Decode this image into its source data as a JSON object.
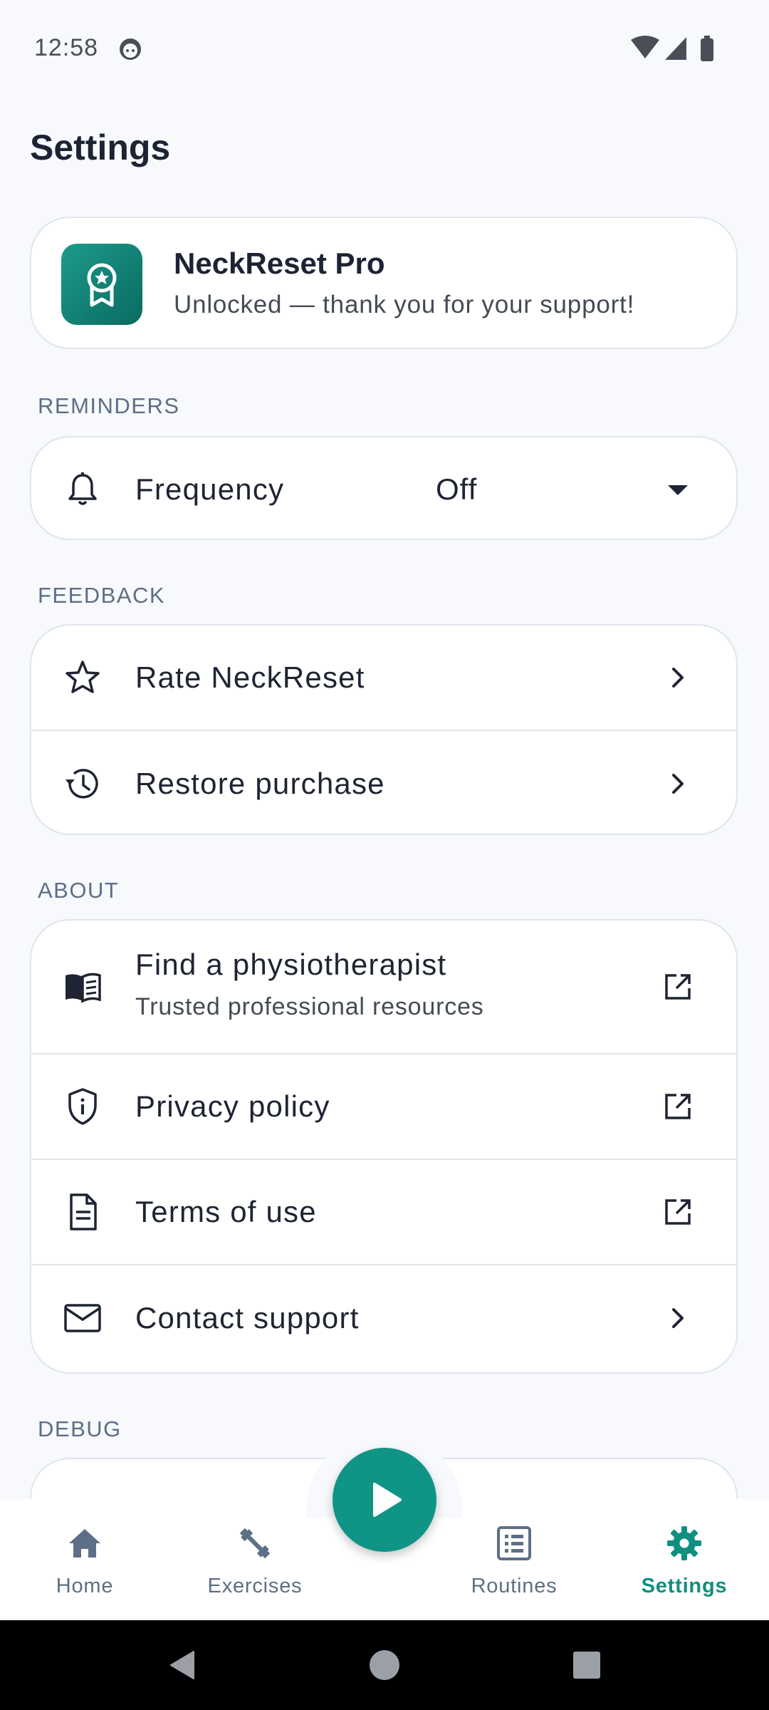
{
  "status_bar": {
    "time": "12:58",
    "notification_icon": "face-icon",
    "icons": [
      "wifi-icon",
      "signal-icon",
      "battery-icon"
    ]
  },
  "page": {
    "title": "Settings"
  },
  "pro_card": {
    "title": "NeckReset Pro",
    "subtitle": "Unlocked — thank you for your support!",
    "icon": "award-badge-icon"
  },
  "sections": {
    "reminders": {
      "header": "REMINDERS",
      "frequency_label": "Frequency",
      "frequency_value": "Off"
    },
    "feedback": {
      "header": "FEEDBACK",
      "rate_label": "Rate NeckReset",
      "restore_label": "Restore purchase"
    },
    "about": {
      "header": "ABOUT",
      "physio_label": "Find a physiotherapist",
      "physio_sub": "Trusted professional resources",
      "privacy_label": "Privacy policy",
      "terms_label": "Terms of use",
      "contact_label": "Contact support"
    },
    "debug": {
      "header": "DEBUG"
    }
  },
  "bottom_nav": {
    "items": [
      {
        "label": "Home",
        "icon": "home-icon"
      },
      {
        "label": "Exercises",
        "icon": "dumbbell-icon"
      },
      {
        "label": "Routines",
        "icon": "list-icon"
      },
      {
        "label": "Settings",
        "icon": "gear-icon",
        "active": true
      }
    ],
    "fab_icon": "play-icon"
  },
  "colors": {
    "accent": "#0f9485",
    "background": "#f7f9fc",
    "card": "#ffffff",
    "section_header": "#5d6f86",
    "text_primary": "#1e2433"
  }
}
